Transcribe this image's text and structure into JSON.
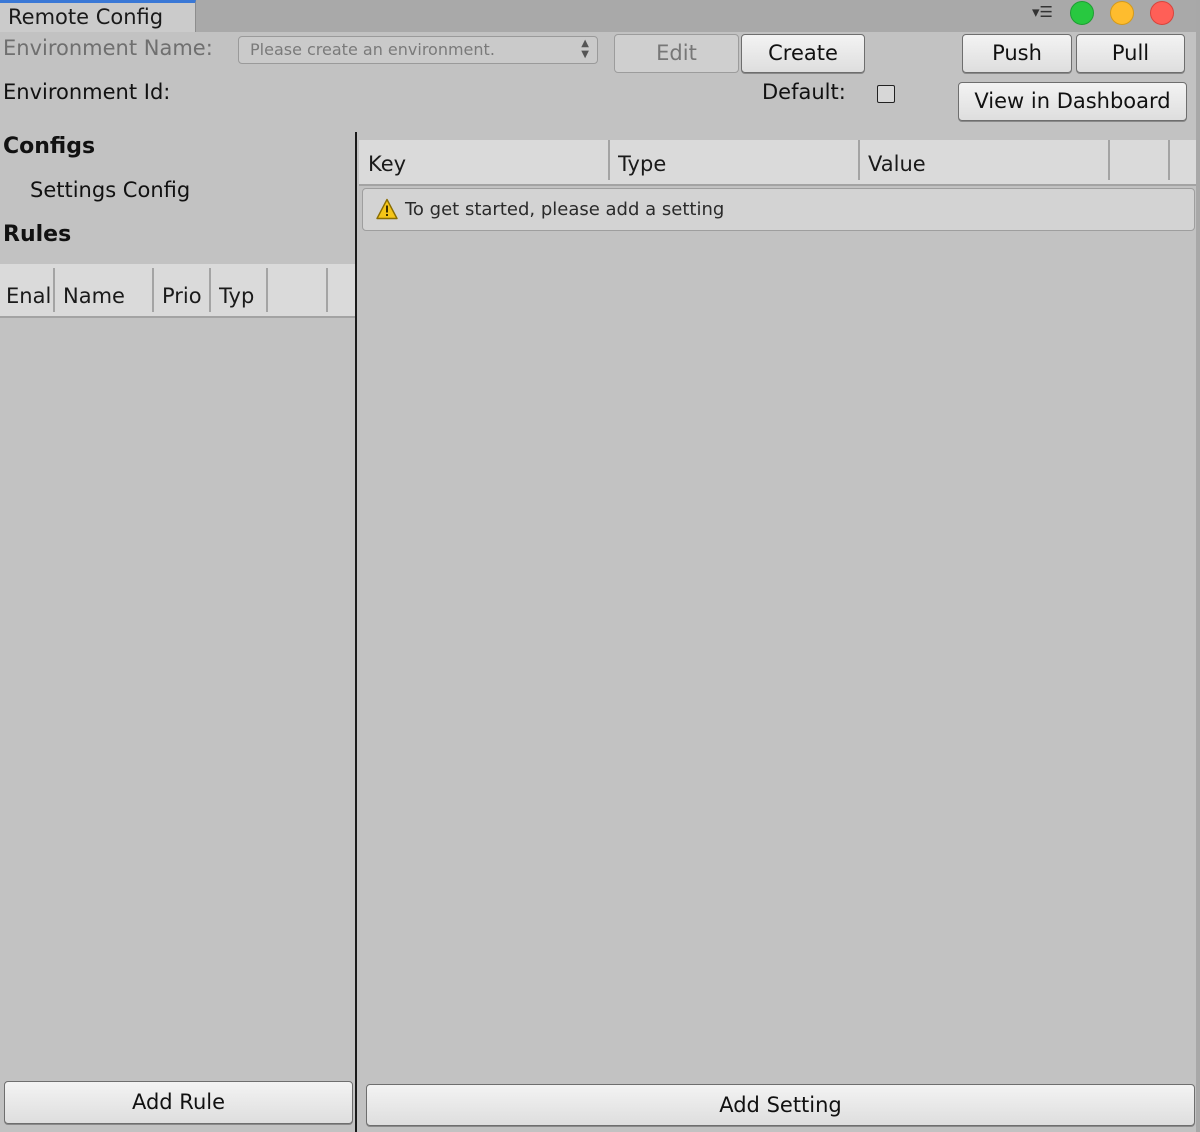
{
  "window": {
    "tab_title": "Remote Config",
    "menu_icon": "menu-icon",
    "controls": [
      "green",
      "yellow",
      "red"
    ]
  },
  "toolbar": {
    "env_name_label": "Environment Name:",
    "env_select_placeholder": "Please create an environment.",
    "edit_label": "Edit",
    "create_label": "Create",
    "push_label": "Push",
    "pull_label": "Pull",
    "env_id_label": "Environment Id:",
    "default_label": "Default:",
    "default_checked": false,
    "dashboard_label": "View in Dashboard"
  },
  "sidebar": {
    "configs_heading": "Configs",
    "settings_config": "Settings Config",
    "rules_heading": "Rules",
    "rules_columns": [
      "Enal",
      "Name",
      "Prio",
      "Typ"
    ],
    "add_rule_label": "Add Rule"
  },
  "settings": {
    "columns": [
      "Key",
      "Type",
      "Value"
    ],
    "notice_icon": "warning-icon",
    "notice_text": "To get started, please add a setting",
    "add_setting_label": "Add Setting"
  }
}
